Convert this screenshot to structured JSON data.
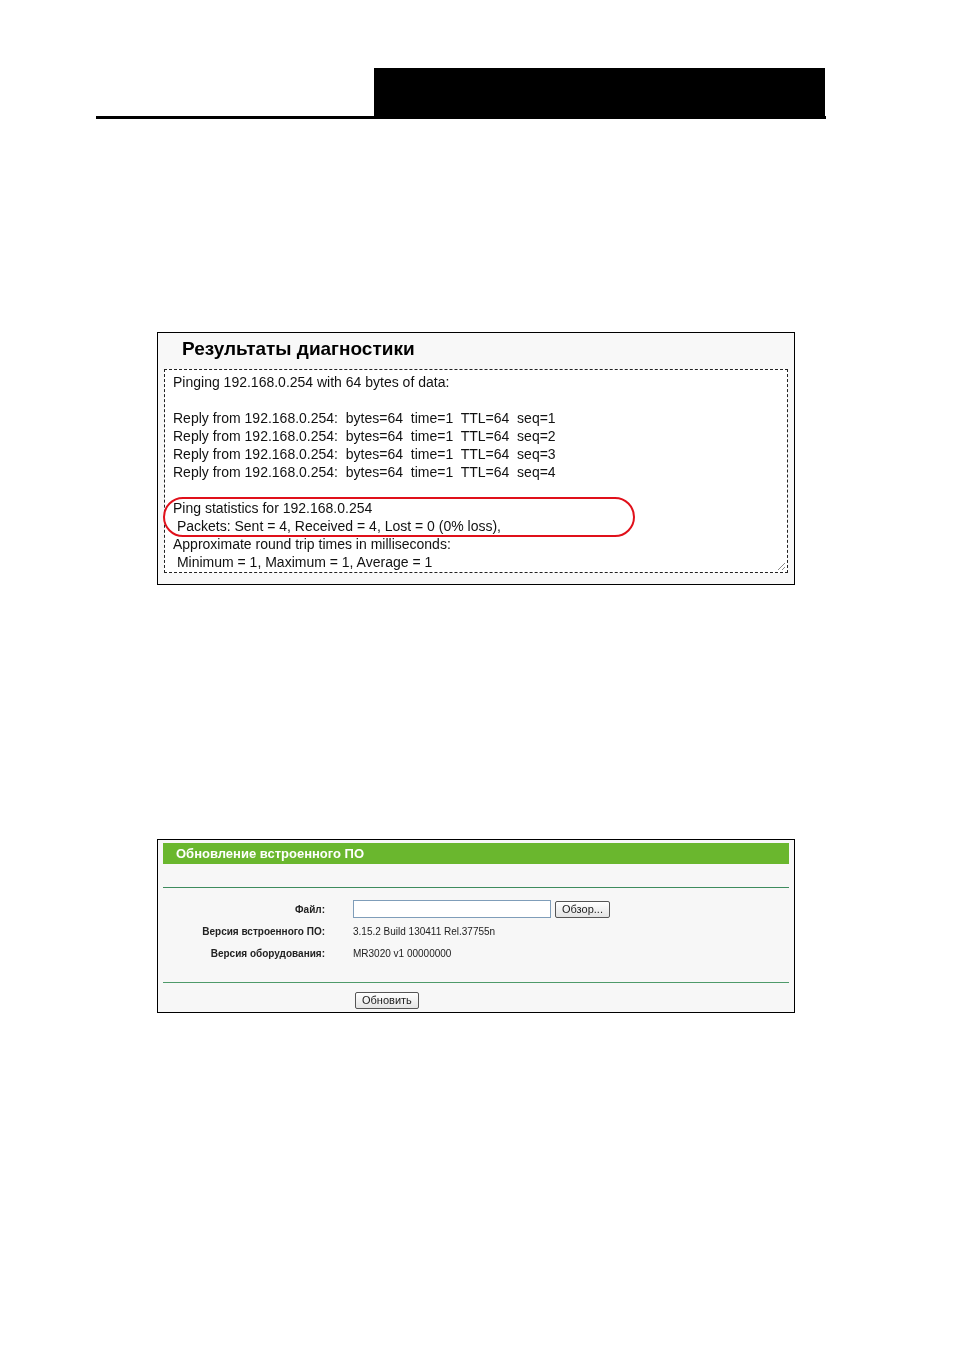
{
  "diagnostics": {
    "title": "Результаты диагностики",
    "header_line": "Pinging 192.168.0.254 with 64 bytes of data:",
    "replies": [
      "Reply from 192.168.0.254:  bytes=64  time=1  TTL=64  seq=1",
      "Reply from 192.168.0.254:  bytes=64  time=1  TTL=64  seq=2",
      "Reply from 192.168.0.254:  bytes=64  time=1  TTL=64  seq=3",
      "Reply from 192.168.0.254:  bytes=64  time=1  TTL=64  seq=4"
    ],
    "statistics": {
      "highlighted": true,
      "lines": [
        "Ping statistics for 192.168.0.254",
        " Packets: Sent = 4, Received = 4, Lost = 0 (0% loss),"
      ]
    },
    "round_trip": [
      "Approximate round trip times in milliseconds:",
      " Minimum = 1, Maximum = 1, Average = 1"
    ]
  },
  "firmware": {
    "title": "Обновление встроенного ПО",
    "file_label": "Файл:",
    "browse_button": "Обзор...",
    "rows": [
      {
        "label": "Версия встроенного ПО:",
        "value": "3.15.2 Build 130411 Rel.37755n"
      },
      {
        "label": "Версия оборудования:",
        "value": "MR3020 v1 00000000"
      }
    ],
    "upgrade_button": "Обновить"
  }
}
